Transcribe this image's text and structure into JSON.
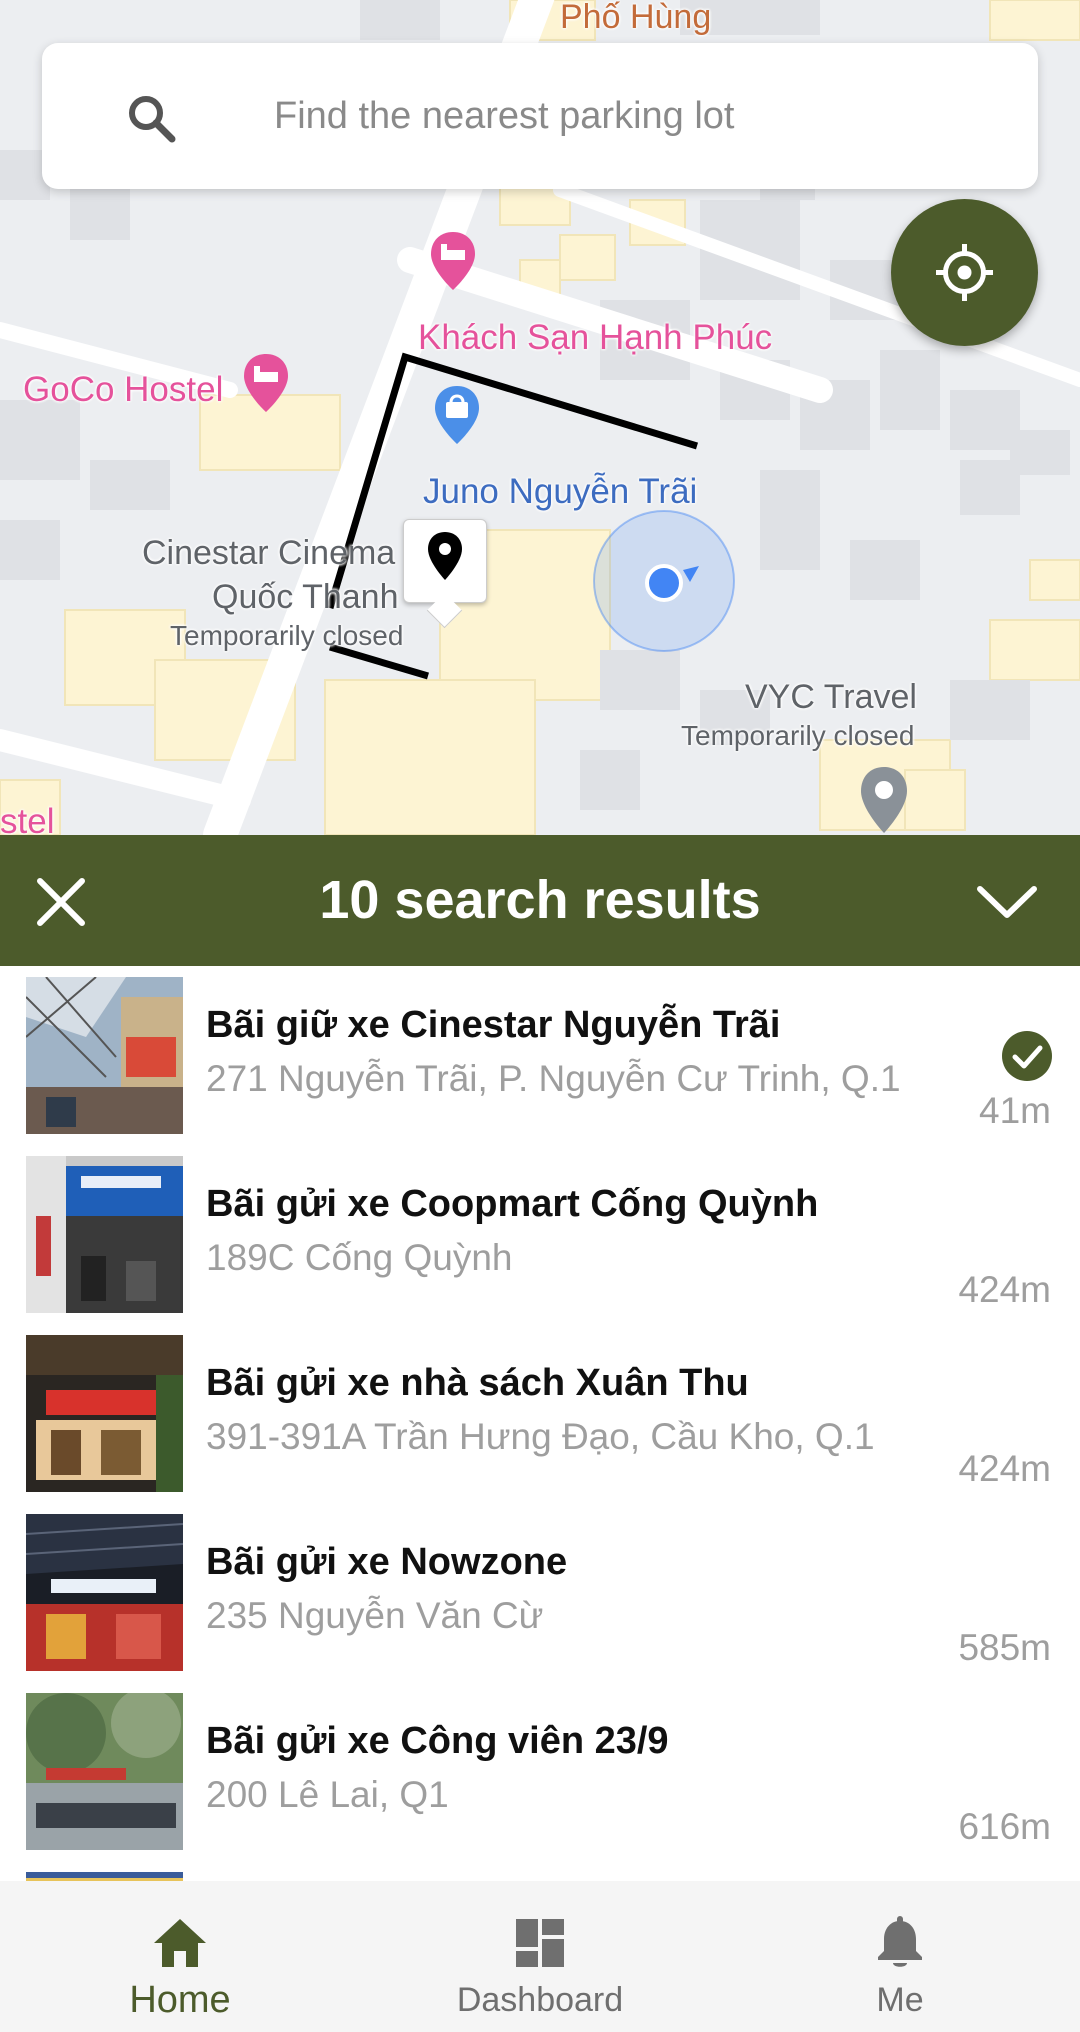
{
  "map": {
    "labels": {
      "pho_hung": "Phố Hùng",
      "hotel": "Khách Sạn Hạnh Phúc",
      "goco": "GoCo Hostel",
      "juno": "Juno Nguyễn Trãi",
      "cinestar_line1": "Cinestar Cinema",
      "cinestar_line2": "Quốc Thanh",
      "cinestar_status": "Temporarily closed",
      "vyc": "VYC Travel",
      "vyc_status": "Temporarily closed",
      "hostel_edge": "stel"
    }
  },
  "search": {
    "placeholder": "Find the nearest parking lot",
    "icon": "search-icon"
  },
  "locate_button": {
    "icon": "my-location-icon"
  },
  "results": {
    "title": "10 search results",
    "close_icon": "close-icon",
    "collapse_icon": "chevron-down-icon",
    "items": [
      {
        "name": "Bãi giữ xe Cinestar Nguyễn Trãi",
        "address": "271 Nguyễn Trãi, P. Nguyễn Cư Trinh, Q.1",
        "distance": "41m",
        "selected": true
      },
      {
        "name": "Bãi gửi xe Coopmart Cống Quỳnh",
        "address": "189C Cống Quỳnh",
        "distance": "424m"
      },
      {
        "name": "Bãi gửi xe nhà sách Xuân Thu",
        "address": "391-391A Trần Hưng Đạo, Cầu Kho, Q.1",
        "distance": "424m"
      },
      {
        "name": "Bãi gửi xe Nowzone",
        "address": "235 Nguyễn Văn Cừ",
        "distance": "585m"
      },
      {
        "name": "Bãi gửi xe Công viên 23/9",
        "address": "200 Lê Lai, Q1",
        "distance": "616m"
      }
    ]
  },
  "nav": {
    "items": [
      {
        "label": "Home",
        "icon": "home-icon",
        "active": true
      },
      {
        "label": "Dashboard",
        "icon": "dashboard-icon"
      },
      {
        "label": "Me",
        "icon": "bell-icon"
      }
    ]
  },
  "colors": {
    "primary": "#4c5b2b",
    "map_bg": "#eceef1",
    "pink_poi": "#e5529b",
    "blue_poi": "#3d6cc0",
    "location_dot": "#4285f4",
    "secondary_text": "#9e9e9e"
  }
}
